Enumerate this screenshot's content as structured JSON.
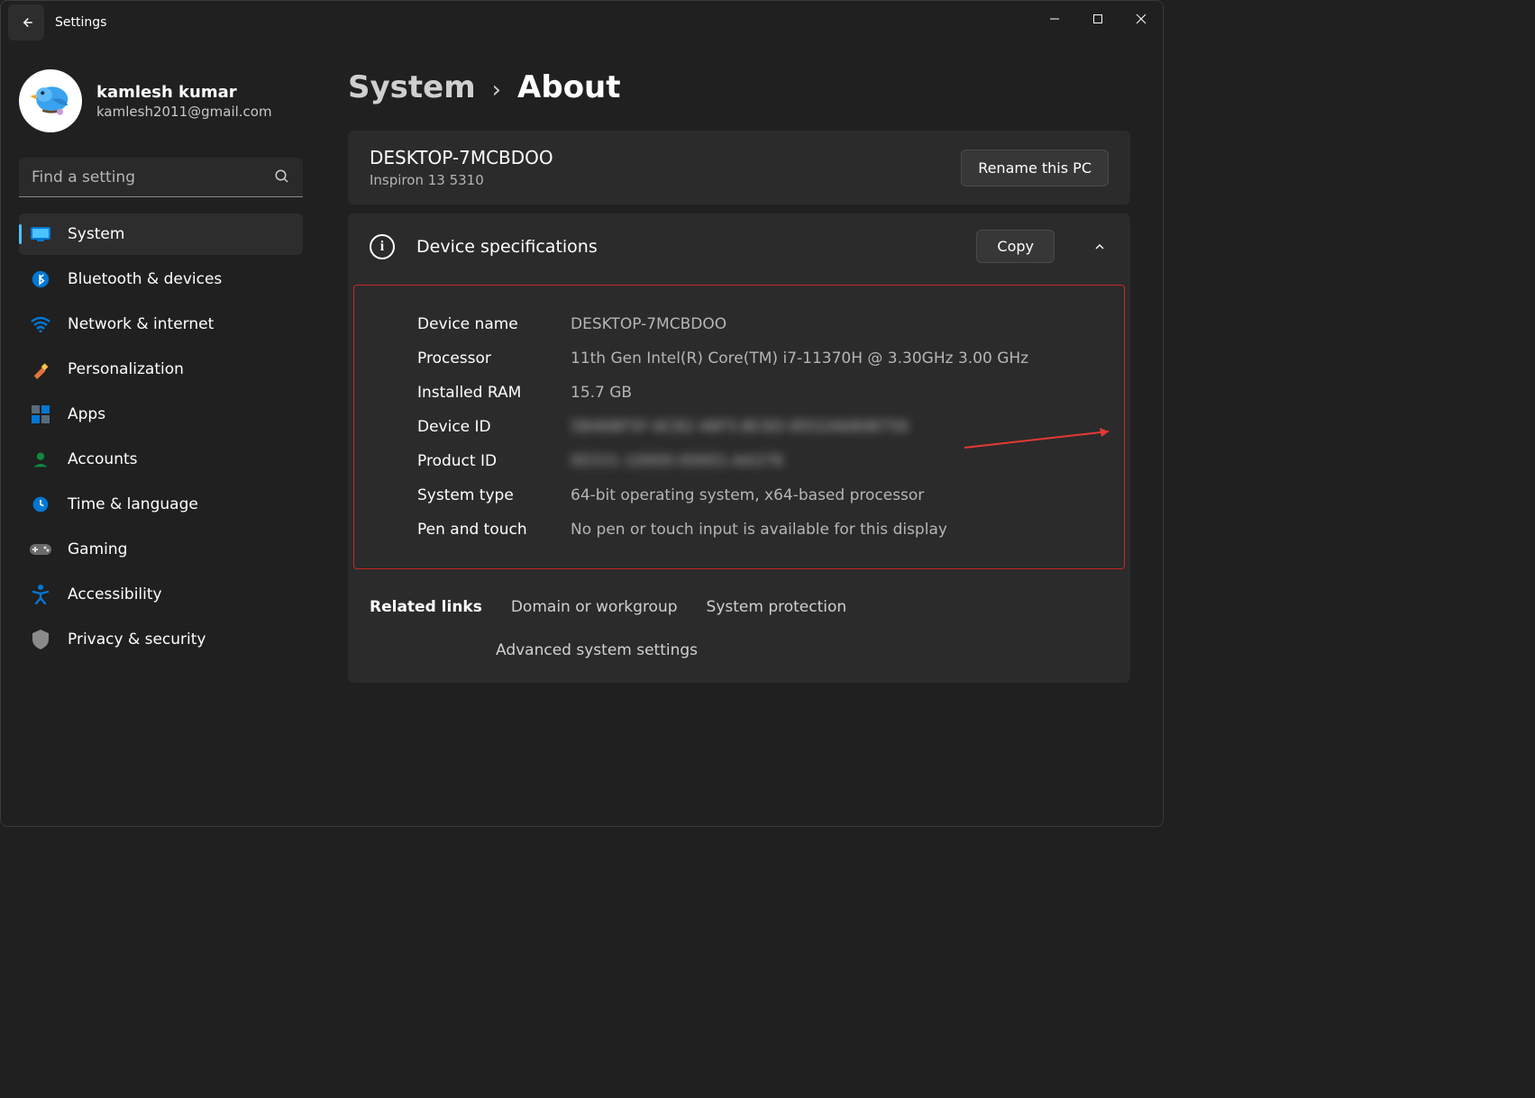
{
  "window": {
    "title": "Settings"
  },
  "user": {
    "name": "kamlesh kumar",
    "email": "kamlesh2011@gmail.com"
  },
  "search": {
    "placeholder": "Find a setting"
  },
  "nav": {
    "items": [
      {
        "label": "System",
        "active": true
      },
      {
        "label": "Bluetooth & devices",
        "active": false
      },
      {
        "label": "Network & internet",
        "active": false
      },
      {
        "label": "Personalization",
        "active": false
      },
      {
        "label": "Apps",
        "active": false
      },
      {
        "label": "Accounts",
        "active": false
      },
      {
        "label": "Time & language",
        "active": false
      },
      {
        "label": "Gaming",
        "active": false
      },
      {
        "label": "Accessibility",
        "active": false
      },
      {
        "label": "Privacy & security",
        "active": false
      }
    ]
  },
  "breadcrumb": {
    "parent": "System",
    "current": "About"
  },
  "pc": {
    "name": "DESKTOP-7MCBDOO",
    "model": "Inspiron 13 5310",
    "rename_label": "Rename this PC"
  },
  "specs": {
    "title": "Device specifications",
    "copy_label": "Copy",
    "rows": [
      {
        "label": "Device name",
        "value": "DESKTOP-7MCBDOO"
      },
      {
        "label": "Processor",
        "value": "11th Gen Intel(R) Core(TM) i7-11370H @ 3.30GHz   3.00 GHz"
      },
      {
        "label": "Installed RAM",
        "value": "15.7 GB"
      },
      {
        "label": "Device ID",
        "value": "5B46BF5F-6C82-48F5-BC6D-8932A680B756",
        "blurred": true
      },
      {
        "label": "Product ID",
        "value": "00331-10000-00001-AA376",
        "blurred": true
      },
      {
        "label": "System type",
        "value": "64-bit operating system, x64-based processor"
      },
      {
        "label": "Pen and touch",
        "value": "No pen or touch input is available for this display"
      }
    ]
  },
  "related": {
    "title": "Related links",
    "links": [
      "Domain or workgroup",
      "System protection",
      "Advanced system settings"
    ]
  }
}
